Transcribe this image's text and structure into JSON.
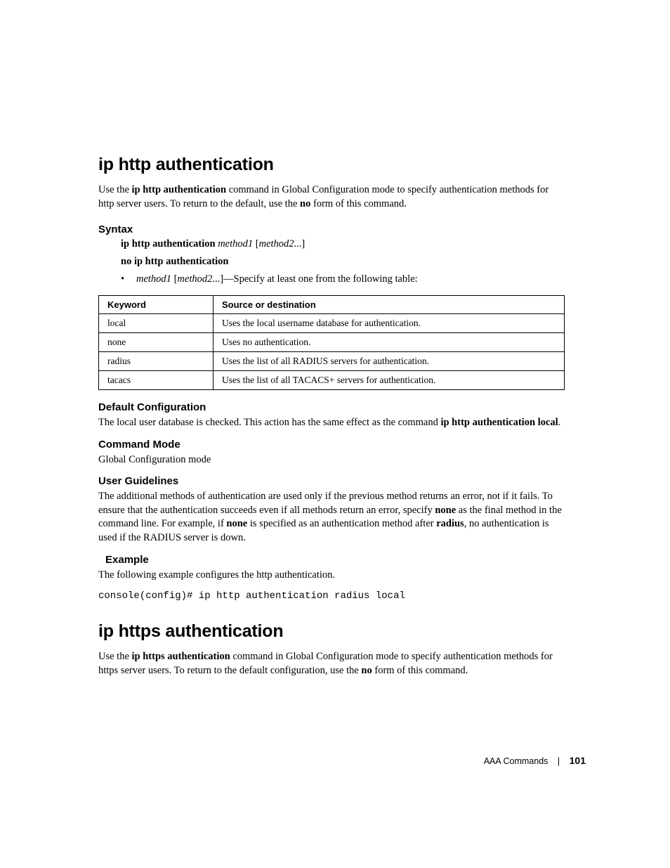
{
  "section1": {
    "title": "ip http authentication",
    "intro_parts": [
      "Use the ",
      "ip http authentication",
      " command in Global Configuration mode to specify authentication methods for http server users. To return to the default, use the ",
      "no",
      " form of this command."
    ],
    "syntax": {
      "heading": "Syntax",
      "line1_bold": "ip http authentication",
      "line1_italic": " method1 ",
      "line1_bracket": "[",
      "line1_italic2": "method2",
      "line1_end": "...]",
      "line2": "no ip http authentication",
      "bullet_italic1": "method1 ",
      "bullet_bracket": "[",
      "bullet_italic2": "method2",
      "bullet_rest": "...]—Specify at least one from the following table:"
    },
    "table": {
      "headers": [
        "Keyword",
        "Source or destination"
      ],
      "rows": [
        [
          "local",
          "Uses the local username database for authentication."
        ],
        [
          "none",
          "Uses no authentication."
        ],
        [
          "radius",
          "Uses the list of all RADIUS servers for authentication."
        ],
        [
          "tacacs",
          "Uses the list of all TACACS+ servers for authentication."
        ]
      ]
    },
    "default_config": {
      "heading": "Default Configuration",
      "text_pre": "The local user database is checked. This action has the same effect as the command ",
      "text_bold": "ip http authentication local",
      "text_post": "."
    },
    "command_mode": {
      "heading": "Command Mode",
      "text": "Global Configuration mode"
    },
    "user_guidelines": {
      "heading": "User Guidelines",
      "parts": [
        "The additional methods of authentication are used only if the previous method returns an error, not if it fails. To ensure that the authentication succeeds even if all methods return an error, specify ",
        "none",
        " as the final method in the command line. For example, if ",
        "none",
        " is specified as an authentication method after ",
        "radius",
        ", no authentication is used if the RADIUS server is down."
      ]
    },
    "example": {
      "heading": "Example",
      "text": "The following example configures the http authentication.",
      "console": "console(config)# ip http authentication radius local"
    }
  },
  "section2": {
    "title": "ip https authentication",
    "intro_parts": [
      "Use the ",
      "ip https authentication",
      " command in Global Configuration mode to specify authentication methods for https server users. To return to the default configuration, use the ",
      "no",
      " form of this command."
    ]
  },
  "footer": {
    "chapter": "AAA Commands",
    "page": "101"
  }
}
